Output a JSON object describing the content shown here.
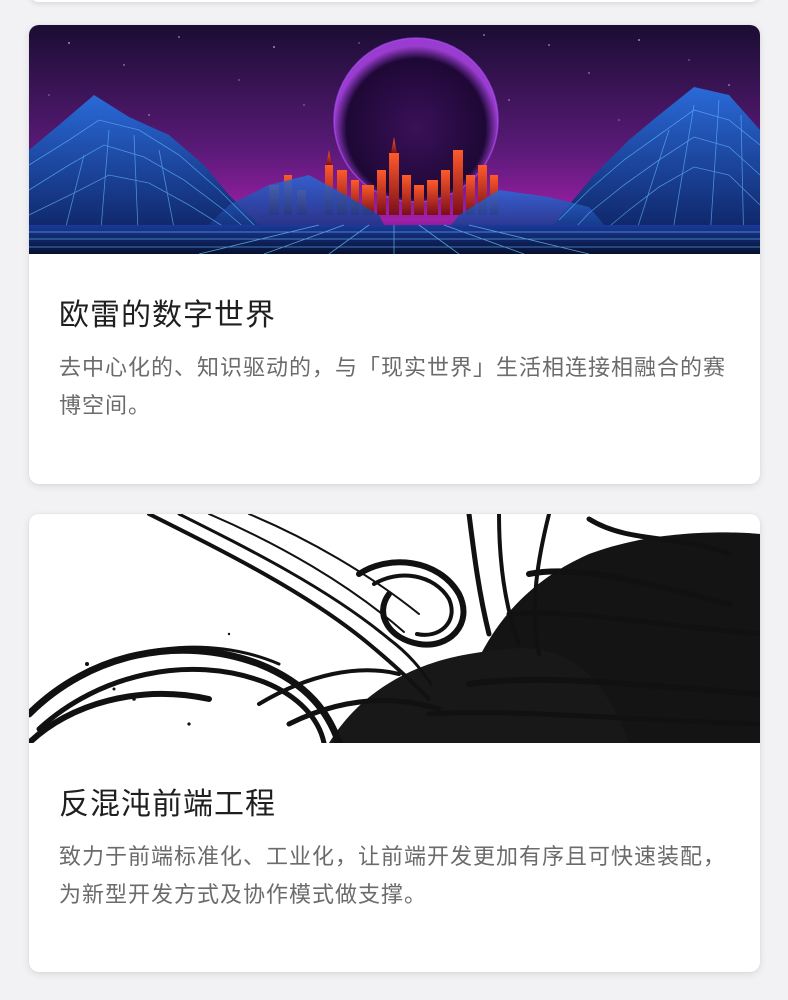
{
  "cards": [
    {
      "title": "欧雷的数字世界",
      "description": "去中心化的、知识驱动的，与「现实世界」生活相连接相融合的赛博空间。",
      "banner_icon": "synthwave-city-banner"
    },
    {
      "title": "反混沌前端工程",
      "description": "致力于前端标准化、工业化，让前端开发更加有序且可快速装配，为新型开发方式及协作模式做支撑。",
      "banner_icon": "ink-scribble-banner"
    }
  ],
  "colors": {
    "page_background": "#f2f2f4",
    "card_background": "#ffffff",
    "title_text": "#1f1f1f",
    "description_text": "#6b6b6b"
  }
}
